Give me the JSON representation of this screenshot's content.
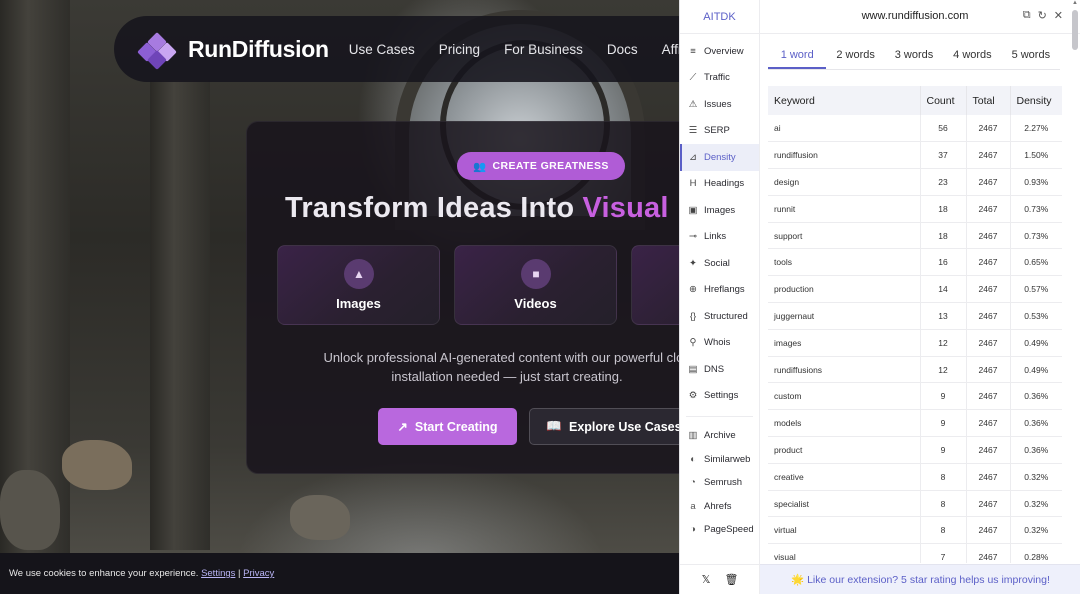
{
  "site": {
    "logo_text": "RunDiffusion",
    "nav": [
      "Use Cases",
      "Pricing",
      "For Business",
      "Docs",
      "Affiliat"
    ],
    "badge": "CREATE GREATNESS",
    "title_main": "Transform Ideas Into ",
    "title_accent": "Visual",
    "media_cards": [
      "Images",
      "Videos"
    ],
    "desc_line1": "Unlock professional AI-generated content with our powerful clou",
    "desc_line2": "installation needed — just start creating.",
    "btn_primary": "Start Creating",
    "btn_secondary": "Explore Use Cases",
    "cookie_text": "We use cookies to enhance your experience.",
    "cookie_settings": "Settings",
    "cookie_sep": "|",
    "cookie_privacy": "Privacy"
  },
  "extension": {
    "brand": "AITDK",
    "domain": "www.rundiffusion.com",
    "sidebar": [
      {
        "label": "Overview",
        "icon": "≡"
      },
      {
        "label": "Traffic",
        "icon": "⟋"
      },
      {
        "label": "Issues",
        "icon": "⚠"
      },
      {
        "label": "SERP",
        "icon": "☰"
      },
      {
        "label": "Density",
        "icon": "⊿"
      },
      {
        "label": "Headings",
        "icon": "H"
      },
      {
        "label": "Images",
        "icon": "▣"
      },
      {
        "label": "Links",
        "icon": "⊸"
      },
      {
        "label": "Social",
        "icon": "✦"
      },
      {
        "label": "Hreflangs",
        "icon": "⊕"
      },
      {
        "label": "Structured",
        "icon": "{}"
      },
      {
        "label": "Whois",
        "icon": "⚲"
      },
      {
        "label": "DNS",
        "icon": "▤"
      },
      {
        "label": "Settings",
        "icon": "⚙"
      }
    ],
    "active_sidebar": "Density",
    "external": [
      {
        "label": "Archive",
        "icon": "▥"
      },
      {
        "label": "Similarweb",
        "icon": "◐"
      },
      {
        "label": "Semrush",
        "icon": "◔"
      },
      {
        "label": "Ahrefs",
        "icon": "a"
      },
      {
        "label": "PageSpeed",
        "icon": "◑"
      }
    ],
    "word_tabs": [
      "1 word",
      "2 words",
      "3 words",
      "4 words",
      "5 words"
    ],
    "active_tab": "1 word",
    "table_headers": [
      "Keyword",
      "Count",
      "Total",
      "Density"
    ],
    "rows": [
      [
        "ai",
        "56",
        "2467",
        "2.27%"
      ],
      [
        "rundiffusion",
        "37",
        "2467",
        "1.50%"
      ],
      [
        "design",
        "23",
        "2467",
        "0.93%"
      ],
      [
        "runnit",
        "18",
        "2467",
        "0.73%"
      ],
      [
        "support",
        "18",
        "2467",
        "0.73%"
      ],
      [
        "tools",
        "16",
        "2467",
        "0.65%"
      ],
      [
        "production",
        "14",
        "2467",
        "0.57%"
      ],
      [
        "juggernaut",
        "13",
        "2467",
        "0.53%"
      ],
      [
        "images",
        "12",
        "2467",
        "0.49%"
      ],
      [
        "rundiffusions",
        "12",
        "2467",
        "0.49%"
      ],
      [
        "custom",
        "9",
        "2467",
        "0.36%"
      ],
      [
        "models",
        "9",
        "2467",
        "0.36%"
      ],
      [
        "product",
        "9",
        "2467",
        "0.36%"
      ],
      [
        "creative",
        "8",
        "2467",
        "0.32%"
      ],
      [
        "specialist",
        "8",
        "2467",
        "0.32%"
      ],
      [
        "virtual",
        "8",
        "2467",
        "0.32%"
      ],
      [
        "visual",
        "7",
        "2467",
        "0.28%"
      ]
    ],
    "footer_msg": "🌟 Like our extension? 5 star rating helps us improving!",
    "accent_color": "#5b5fc7"
  }
}
